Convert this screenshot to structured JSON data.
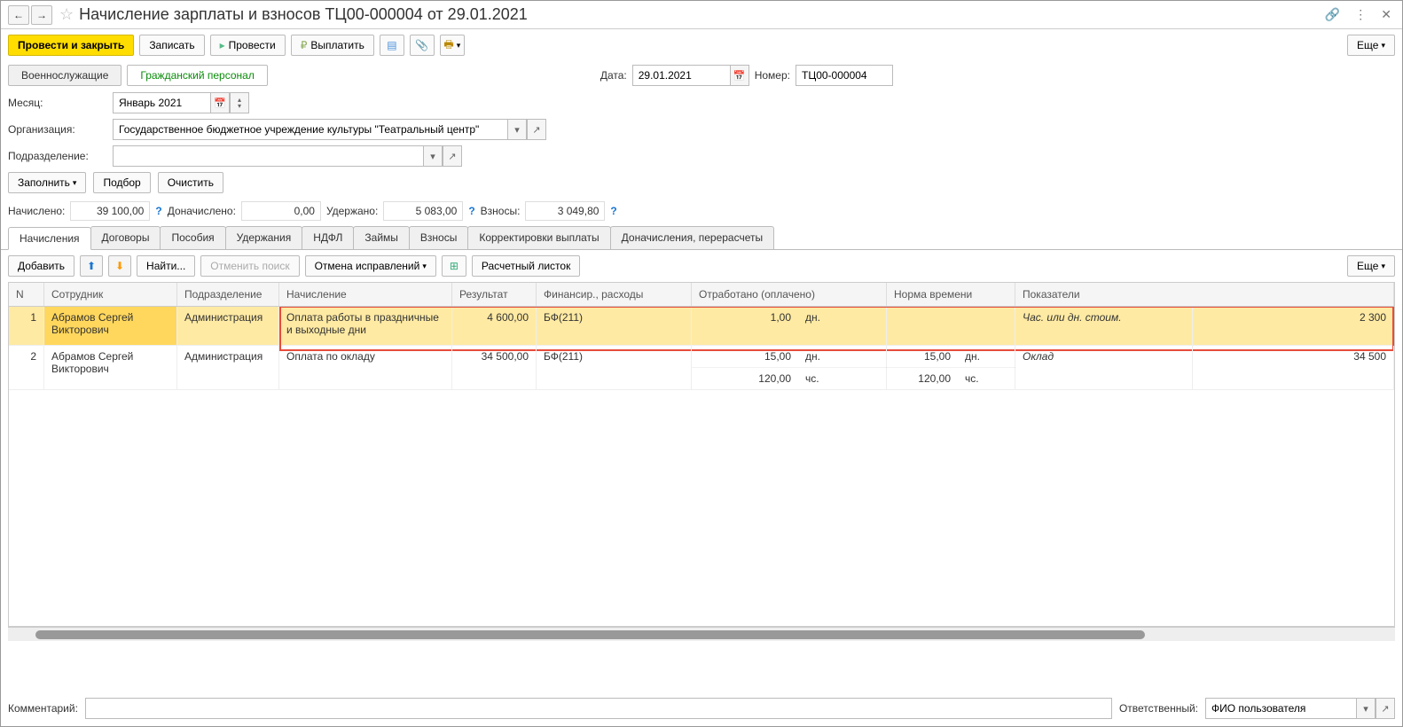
{
  "title": "Начисление зарплаты и взносов ТЦ00-000004 от 29.01.2021",
  "toolbar": {
    "post_close": "Провести и закрыть",
    "write": "Записать",
    "post": "Провести",
    "pay": "Выплатить",
    "more": "Еще"
  },
  "groupTabs": {
    "military": "Военнослужащие",
    "civilian": "Гражданский персонал"
  },
  "header": {
    "date_lbl": "Дата:",
    "date_val": "29.01.2021",
    "num_lbl": "Номер:",
    "num_val": "ТЦ00-000004",
    "month_lbl": "Месяц:",
    "month_val": "Январь 2021",
    "org_lbl": "Организация:",
    "org_val": "Государственное бюджетное учреждение культуры \"Театральный центр\"",
    "dep_lbl": "Подразделение:",
    "dep_val": ""
  },
  "fill": {
    "fill": "Заполнить",
    "pick": "Подбор",
    "clear": "Очистить"
  },
  "totals": {
    "accrued_l": "Начислено:",
    "accrued_v": "39 100,00",
    "add_l": "Доначислено:",
    "add_v": "0,00",
    "withheld_l": "Удержано:",
    "withheld_v": "5 083,00",
    "contrib_l": "Взносы:",
    "contrib_v": "3 049,80"
  },
  "tabs": {
    "t0": "Начисления",
    "t1": "Договоры",
    "t2": "Пособия",
    "t3": "Удержания",
    "t4": "НДФЛ",
    "t5": "Займы",
    "t6": "Взносы",
    "t7": "Корректировки выплаты",
    "t8": "Доначисления, перерасчеты"
  },
  "gridbar": {
    "add": "Добавить",
    "find": "Найти...",
    "cancel_search": "Отменить поиск",
    "cancel_fix": "Отмена исправлений",
    "payslip": "Расчетный листок",
    "more": "Еще"
  },
  "cols": {
    "n": "N",
    "emp": "Сотрудник",
    "dep": "Подразделение",
    "nach": "Начисление",
    "res": "Результат",
    "fin": "Финансир., расходы",
    "otr": "Отработано (оплачено)",
    "norm": "Норма времени",
    "pok": "Показатели"
  },
  "rows": [
    {
      "n": "1",
      "emp": "Абрамов Сергей Викторович",
      "dep": "Администрация",
      "nach": "Оплата работы в праздничные и выходные дни",
      "res": "4 600,00",
      "fin": "БФ(211)",
      "otr_lines": [
        {
          "v": "1,00",
          "u": "дн."
        }
      ],
      "norm_lines": [
        {
          "v": "",
          "u": ""
        }
      ],
      "pok": "Час. или дн. стоим.",
      "val": "2 300"
    },
    {
      "n": "2",
      "emp": "Абрамов Сергей Викторович",
      "dep": "Администрация",
      "nach": "Оплата по окладу",
      "res": "34 500,00",
      "fin": "БФ(211)",
      "otr_lines": [
        {
          "v": "15,00",
          "u": "дн."
        },
        {
          "v": "120,00",
          "u": "чс."
        }
      ],
      "norm_lines": [
        {
          "v": "15,00",
          "u": "дн."
        },
        {
          "v": "120,00",
          "u": "чс."
        }
      ],
      "pok": "Оклад",
      "val": "34 500"
    }
  ],
  "footer": {
    "comment_l": "Комментарий:",
    "comment_v": "",
    "resp_l": "Ответственный:",
    "resp_v": "ФИО пользователя"
  }
}
